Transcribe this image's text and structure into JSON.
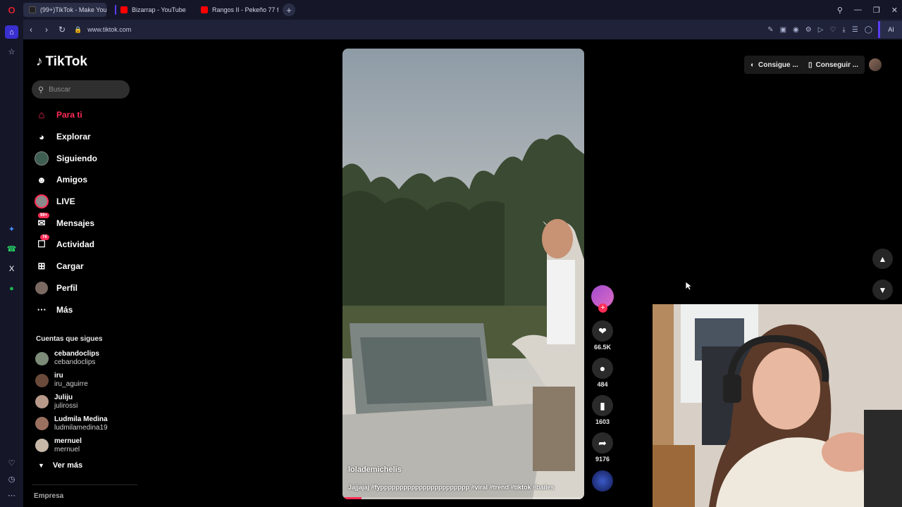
{
  "browser": {
    "tabs": [
      {
        "title": "(99+)TikTok - Make Your",
        "favicon_color": "#111111",
        "active": true
      },
      {
        "title": "Bizarrap - YouTube",
        "favicon_color": "#ff0000",
        "active": false
      },
      {
        "title": "Rangos II - Pekeño 77 ft. C",
        "favicon_color": "#ff0000",
        "active": false
      }
    ],
    "new_tab_icon": "plus-icon",
    "url": "www.tiktok.com",
    "ai_label": "AI"
  },
  "sidebar": {
    "logo_text": "TikTok",
    "search_placeholder": "Buscar",
    "nav": [
      {
        "label": "Para ti",
        "icon": "home-icon",
        "active": true
      },
      {
        "label": "Explorar",
        "icon": "compass-icon",
        "active": false
      },
      {
        "label": "Siguiendo",
        "icon": "following-avatar-icon",
        "active": false
      },
      {
        "label": "Amigos",
        "icon": "friends-icon",
        "active": false
      },
      {
        "label": "LIVE",
        "icon": "live-icon",
        "active": false
      },
      {
        "label": "Mensajes",
        "icon": "messages-icon",
        "badge": "99+",
        "active": false
      },
      {
        "label": "Actividad",
        "icon": "activity-icon",
        "badge": "76",
        "active": false
      },
      {
        "label": "Cargar",
        "icon": "upload-icon",
        "active": false
      },
      {
        "label": "Perfil",
        "icon": "profile-icon",
        "active": false
      },
      {
        "label": "Más",
        "icon": "more-icon",
        "active": false
      }
    ],
    "following_title": "Cuentas que sigues",
    "following": [
      {
        "name": "cebandoclips",
        "handle": "cebandoclips",
        "color": "#7c8c78"
      },
      {
        "name": "iru",
        "handle": "iru_aguirre",
        "color": "#6a4a3a"
      },
      {
        "name": "Juliju",
        "handle": "julirossi",
        "color": "#b89a8a"
      },
      {
        "name": "Ludmila Medina",
        "handle": "ludmilamedina19",
        "color": "#9a7060"
      },
      {
        "name": "mernuel",
        "handle": "mernuel",
        "color": "#c8b8a8"
      }
    ],
    "see_more": "Ver más",
    "footer": "Empresa"
  },
  "video": {
    "username": "lolademichelis",
    "caption": "Jajjajaj #fyppppppppppppppppppppppp #viral #trend #tiktok #bailes",
    "progress": 0.08
  },
  "actions": {
    "likes": "66.5K",
    "comments": "484",
    "saves": "1603",
    "shares": "9176"
  },
  "header": {
    "get_coins": "Consigue ...",
    "get_app": "Conseguir ..."
  }
}
